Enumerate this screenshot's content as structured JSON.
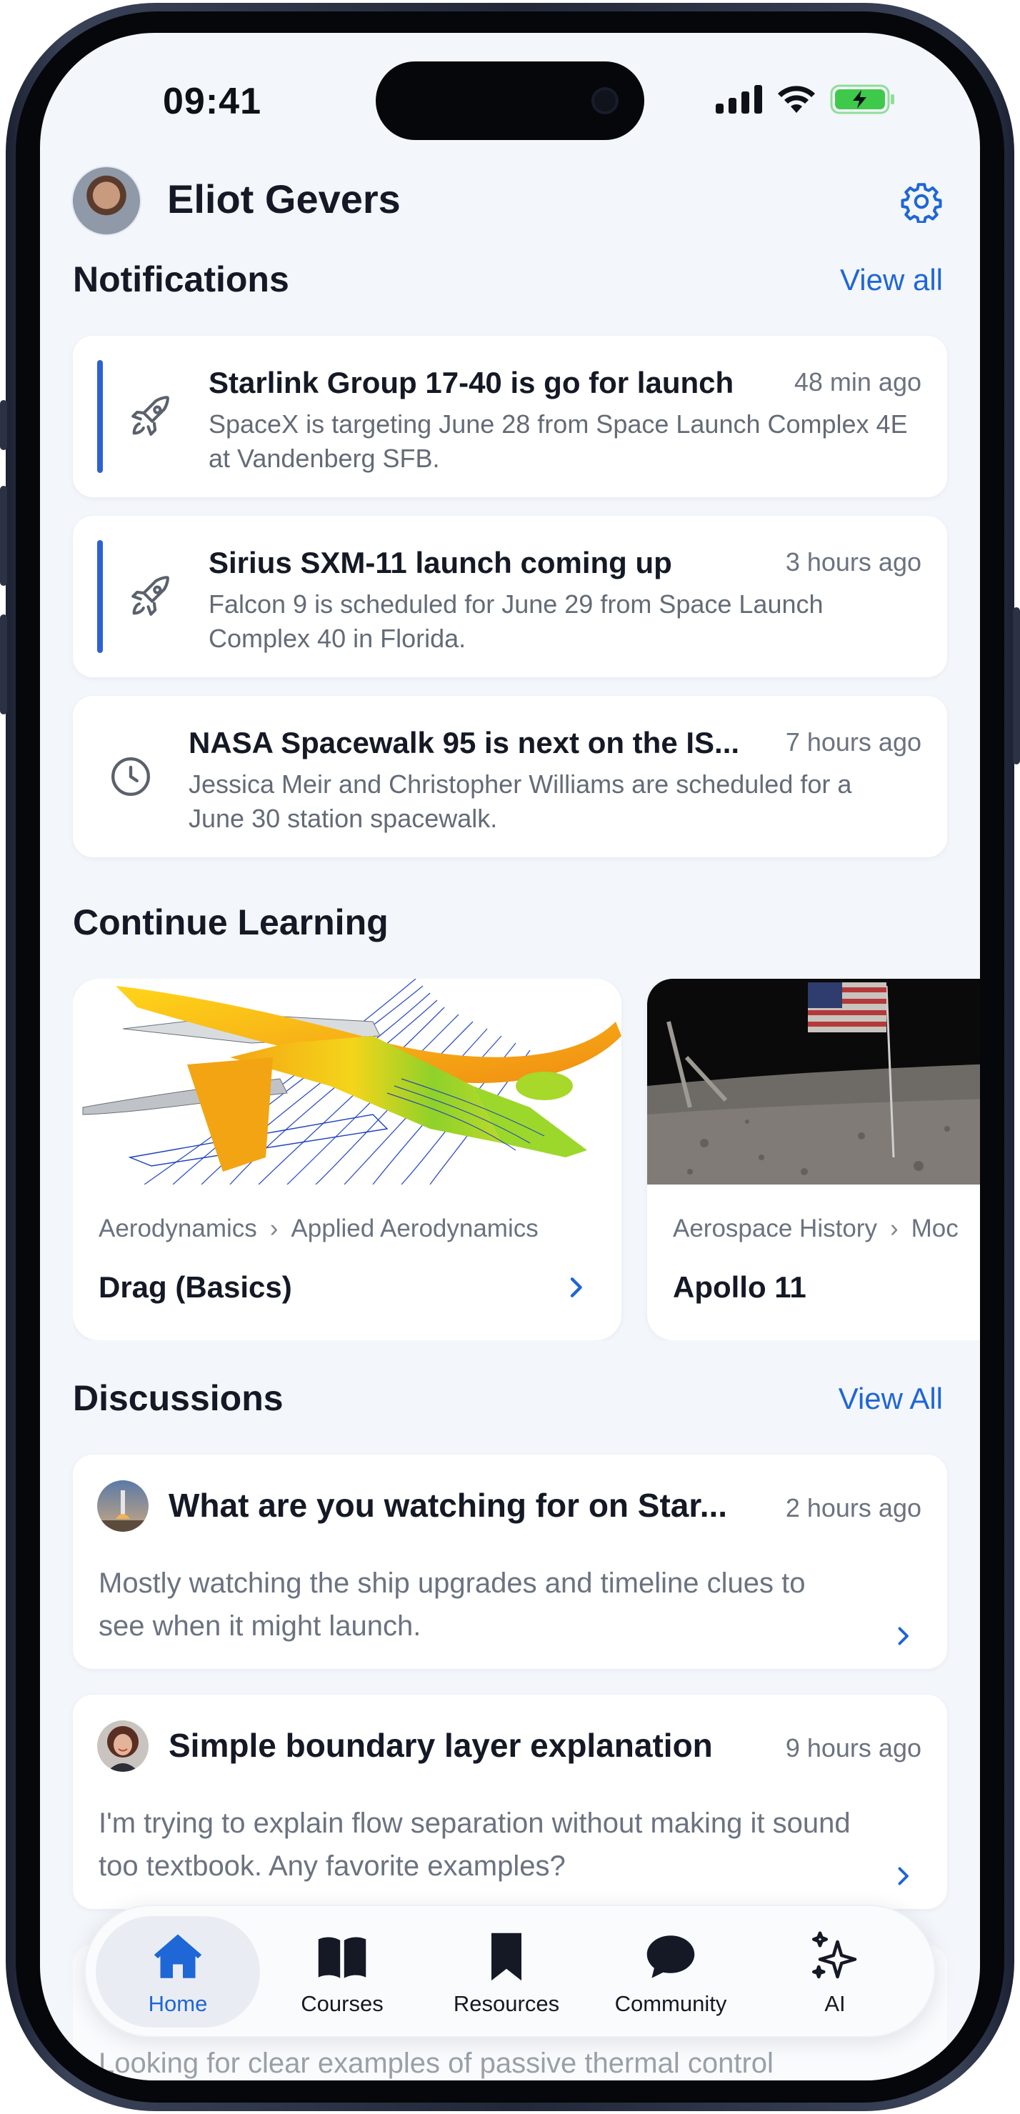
{
  "status_bar": {
    "time": "09:41"
  },
  "header": {
    "user_name": "Eliot Gevers"
  },
  "notifications": {
    "title": "Notifications",
    "view_all": "View all",
    "items": [
      {
        "title": "Starlink Group 17-40 is go for launch",
        "time": "48 min ago",
        "body": "SpaceX is targeting June 28 from Space Launch Complex 4E at Vandenberg SFB.",
        "icon": "rocket-icon",
        "unread": true
      },
      {
        "title": "Sirius SXM-11 launch coming up",
        "time": "3 hours ago",
        "body": "Falcon 9 is scheduled for June 29 from Space Launch Complex 40 in Florida.",
        "icon": "rocket-icon",
        "unread": true
      },
      {
        "title": "NASA Spacewalk 95 is next on the IS...",
        "time": "7 hours ago",
        "body": "Jessica Meir and Christopher Williams are scheduled for a June 30 station spacewalk.",
        "icon": "clock-icon",
        "unread": false
      }
    ]
  },
  "learning": {
    "title": "Continue Learning",
    "courses": [
      {
        "category": "Aerodynamics",
        "subcategory": "Applied Aerodynamics",
        "name": "Drag (Basics)"
      },
      {
        "category": "Aerospace History",
        "subcategory": "Moc",
        "name": "Apollo 11"
      }
    ]
  },
  "discussions": {
    "title": "Discussions",
    "view_all": "View All",
    "items": [
      {
        "title": "What are you watching for on Star...",
        "time": "2 hours ago",
        "body": "Mostly watching the ship upgrades and timeline clues to see when it might launch."
      },
      {
        "title": "Simple boundary layer explanation",
        "time": "9 hours ago",
        "body": "I'm trying to explain flow separation without making it sound too textbook. Any favorite examples?"
      }
    ],
    "partial_text": "Looking for clear examples of passive thermal control"
  },
  "tabbar": {
    "tabs": [
      {
        "label": "Home",
        "icon": "home-icon",
        "active": true
      },
      {
        "label": "Courses",
        "icon": "book-icon",
        "active": false
      },
      {
        "label": "Resources",
        "icon": "bookmark-icon",
        "active": false
      },
      {
        "label": "Community",
        "icon": "chat-bubble-icon",
        "active": false
      },
      {
        "label": "AI",
        "icon": "sparkles-icon",
        "active": false
      }
    ]
  },
  "colors": {
    "accent": "#1f66d6",
    "unread_bar": "#2e62d4",
    "background": "#f3f6fa",
    "battery": "#3fc94a"
  }
}
